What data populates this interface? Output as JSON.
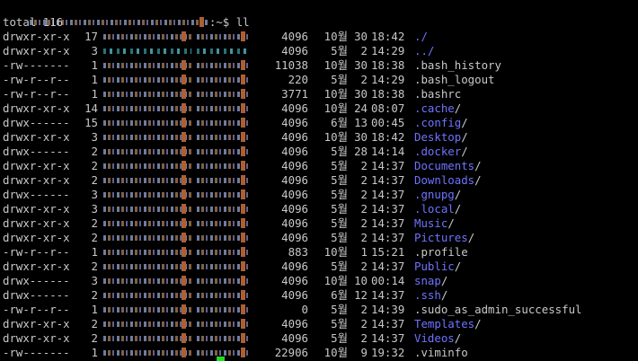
{
  "terminal": {
    "prompt_suffix": ":~$ ",
    "command": "ll",
    "total": "total 116",
    "entries": [
      {
        "perm": "drwxr-xr-x",
        "links": "17",
        "size": "4096",
        "month": "10월",
        "day": "30",
        "time": "18:42",
        "name": "./",
        "dir": true
      },
      {
        "perm": "drwxr-xr-x",
        "links": "3",
        "size": "4096",
        "month": "5월",
        "day": "2",
        "time": "14:29",
        "name": "../",
        "dir": true
      },
      {
        "perm": "-rw-------",
        "links": "1",
        "size": "11038",
        "month": "10월",
        "day": "30",
        "time": "18:38",
        "name": ".bash_history",
        "dir": false
      },
      {
        "perm": "-rw-r--r--",
        "links": "1",
        "size": "220",
        "month": "5월",
        "day": "2",
        "time": "14:29",
        "name": ".bash_logout",
        "dir": false
      },
      {
        "perm": "-rw-r--r--",
        "links": "1",
        "size": "3771",
        "month": "10월",
        "day": "30",
        "time": "18:38",
        "name": ".bashrc",
        "dir": false
      },
      {
        "perm": "drwxr-xr-x",
        "links": "14",
        "size": "4096",
        "month": "10월",
        "day": "24",
        "time": "08:07",
        "name": ".cache",
        "dir": true
      },
      {
        "perm": "drwx------",
        "links": "15",
        "size": "4096",
        "month": "6월",
        "day": "13",
        "time": "00:45",
        "name": ".config",
        "dir": true
      },
      {
        "perm": "drwxr-xr-x",
        "links": "3",
        "size": "4096",
        "month": "10월",
        "day": "30",
        "time": "18:42",
        "name": "Desktop",
        "dir": true
      },
      {
        "perm": "drwx------",
        "links": "2",
        "size": "4096",
        "month": "5월",
        "day": "28",
        "time": "14:14",
        "name": ".docker",
        "dir": true
      },
      {
        "perm": "drwxr-xr-x",
        "links": "2",
        "size": "4096",
        "month": "5월",
        "day": "2",
        "time": "14:37",
        "name": "Documents",
        "dir": true
      },
      {
        "perm": "drwxr-xr-x",
        "links": "2",
        "size": "4096",
        "month": "5월",
        "day": "2",
        "time": "14:37",
        "name": "Downloads",
        "dir": true
      },
      {
        "perm": "drwx------",
        "links": "3",
        "size": "4096",
        "month": "5월",
        "day": "2",
        "time": "14:37",
        "name": ".gnupg",
        "dir": true
      },
      {
        "perm": "drwxr-xr-x",
        "links": "3",
        "size": "4096",
        "month": "5월",
        "day": "2",
        "time": "14:37",
        "name": ".local",
        "dir": true
      },
      {
        "perm": "drwxr-xr-x",
        "links": "2",
        "size": "4096",
        "month": "5월",
        "day": "2",
        "time": "14:37",
        "name": "Music",
        "dir": true
      },
      {
        "perm": "drwxr-xr-x",
        "links": "2",
        "size": "4096",
        "month": "5월",
        "day": "2",
        "time": "14:37",
        "name": "Pictures",
        "dir": true
      },
      {
        "perm": "-rw-r--r--",
        "links": "1",
        "size": "883",
        "month": "10월",
        "day": "1",
        "time": "15:21",
        "name": ".profile",
        "dir": false
      },
      {
        "perm": "drwxr-xr-x",
        "links": "2",
        "size": "4096",
        "month": "5월",
        "day": "2",
        "time": "14:37",
        "name": "Public",
        "dir": true
      },
      {
        "perm": "drwx------",
        "links": "3",
        "size": "4096",
        "month": "10월",
        "day": "10",
        "time": "00:14",
        "name": "snap",
        "dir": true
      },
      {
        "perm": "drwx------",
        "links": "2",
        "size": "4096",
        "month": "6월",
        "day": "12",
        "time": "14:37",
        "name": ".ssh",
        "dir": true
      },
      {
        "perm": "-rw-r--r--",
        "links": "1",
        "size": "0",
        "month": "5월",
        "day": "2",
        "time": "14:39",
        "name": ".sudo_as_admin_successful",
        "dir": false
      },
      {
        "perm": "drwxr-xr-x",
        "links": "2",
        "size": "4096",
        "month": "5월",
        "day": "2",
        "time": "14:37",
        "name": "Templates",
        "dir": true
      },
      {
        "perm": "drwxr-xr-x",
        "links": "2",
        "size": "4096",
        "month": "5월",
        "day": "2",
        "time": "14:37",
        "name": "Videos",
        "dir": true
      },
      {
        "perm": "-rw-------",
        "links": "1",
        "size": "22906",
        "month": "10월",
        "day": "9",
        "time": "19:32",
        "name": ".viminfo",
        "dir": false
      }
    ]
  },
  "colors": {
    "background": "#000000",
    "text": "#c8c8c8",
    "directory": "#6f73ff",
    "cursor": "#22dd22"
  }
}
